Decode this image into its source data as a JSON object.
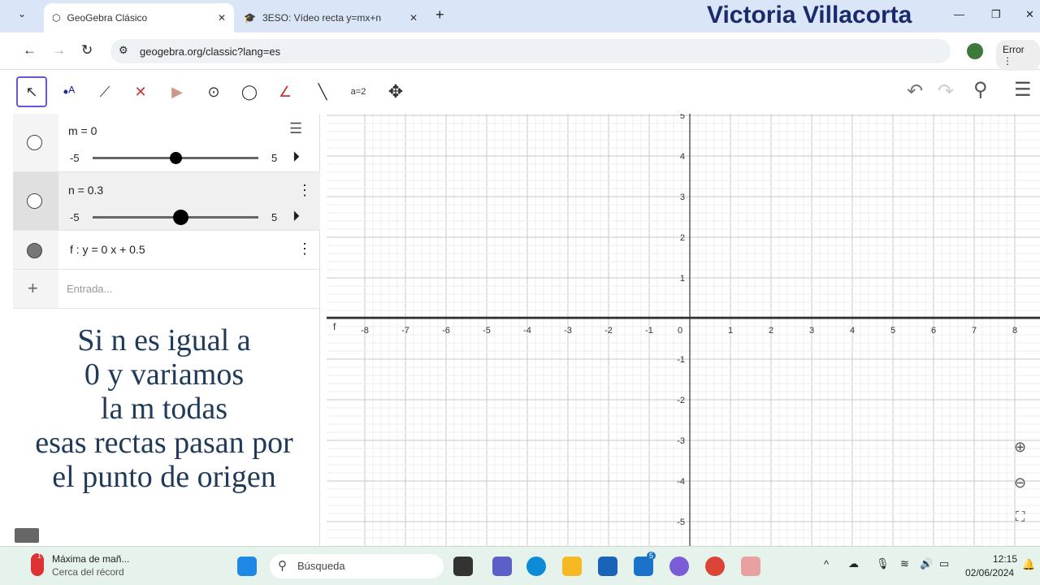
{
  "browser": {
    "tabs": [
      {
        "title": "GeoGebra Clásico"
      },
      {
        "title": "3ESO: Vídeo recta y=mx+n"
      }
    ],
    "overlay_name": "Victoria Villacorta",
    "url": "geogebra.org/classic?lang=es",
    "error_label": "Error"
  },
  "toolbar": {
    "tools": [
      "move",
      "point",
      "line",
      "perpendicular",
      "polygon",
      "circle",
      "conic",
      "angle",
      "reflect",
      "slider",
      "move-graphics"
    ],
    "slider_tool_label": "a=2"
  },
  "algebra": {
    "m": {
      "label": "m = 0",
      "min": "-5",
      "max": "5",
      "value": 0
    },
    "n": {
      "label": "n = 0.3",
      "min": "-5",
      "max": "5",
      "value": 0.3
    },
    "f": {
      "label": "f : y = 0 x + 0.5"
    },
    "input_placeholder": "Entrada..."
  },
  "note": [
    "Si n es igual a",
    "0 y variamos",
    "la m todas",
    "esas rectas pasan por",
    "el punto de origen"
  ],
  "graph": {
    "x_ticks": [
      "-8",
      "-7",
      "-6",
      "-5",
      "-4",
      "-3",
      "-2",
      "-1",
      "0",
      "1",
      "2",
      "3",
      "4",
      "5",
      "6",
      "7",
      "8"
    ],
    "y_ticks": [
      "5",
      "4",
      "3",
      "2",
      "1",
      "-1",
      "-2",
      "-3",
      "-4",
      "-5"
    ],
    "line_label": "f"
  },
  "taskbar": {
    "weather_title": "Máxima de mañ...",
    "weather_sub": "Cerca del récord",
    "weather_badge": "1",
    "search": "Búsqueda",
    "mail_badge": "5",
    "time": "12:15",
    "date": "02/06/2024"
  }
}
